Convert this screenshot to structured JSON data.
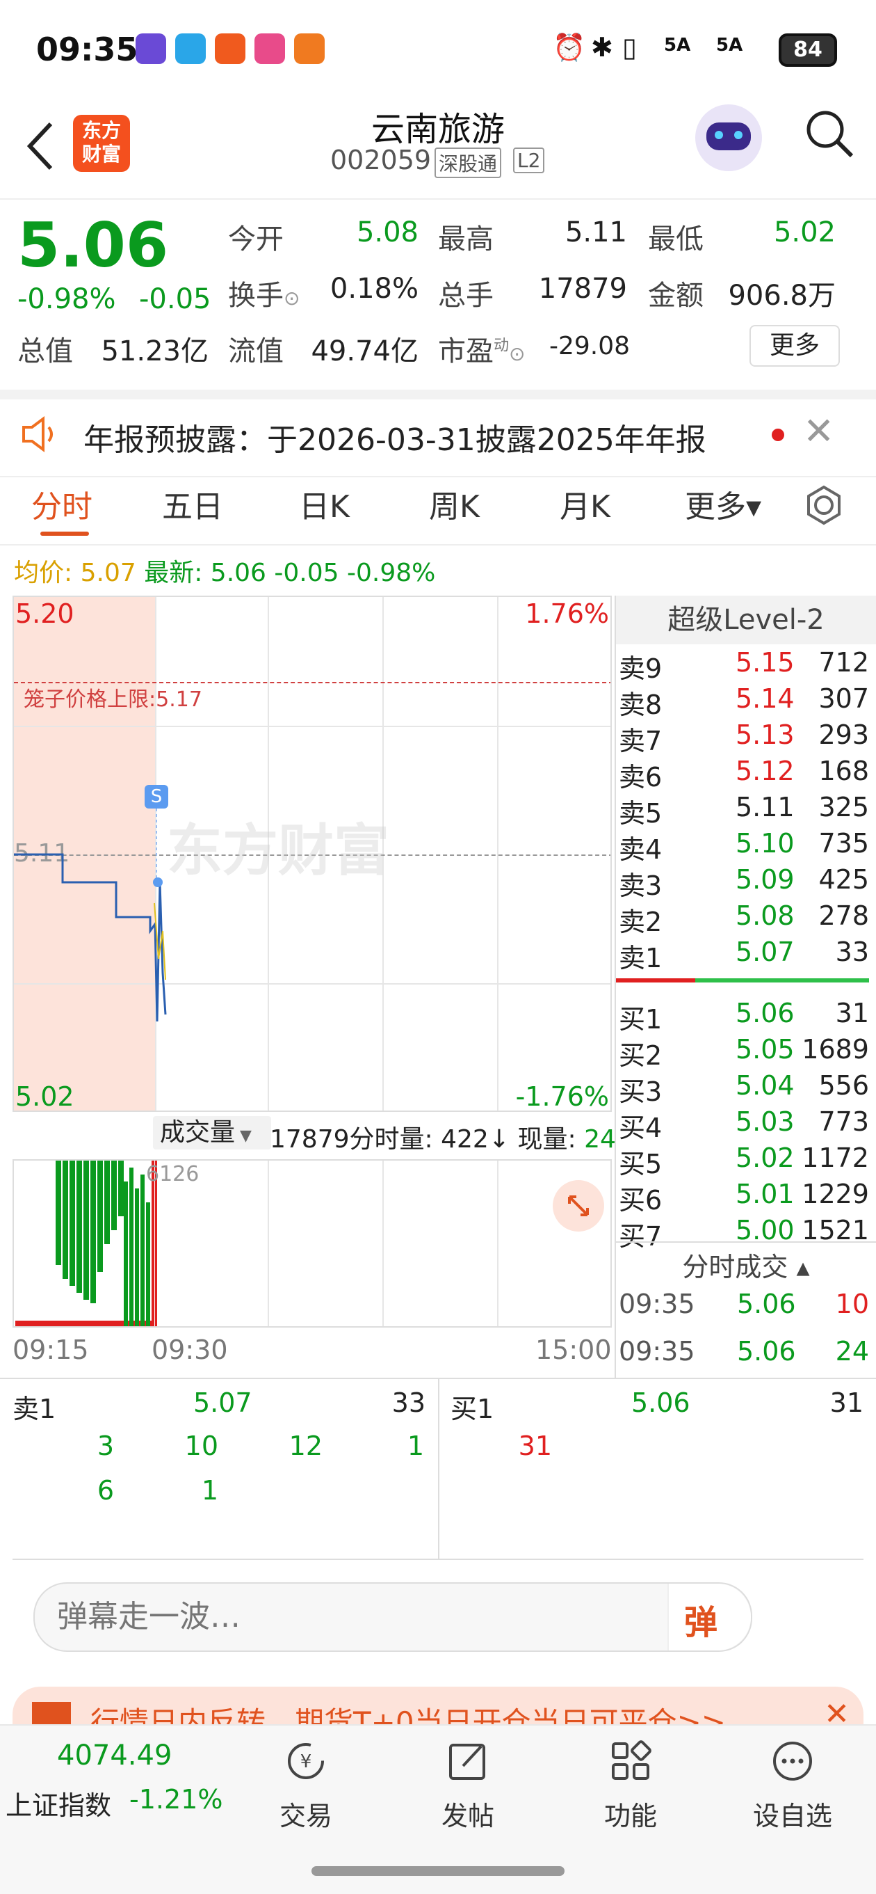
{
  "status_bar": {
    "time": "09:35",
    "battery": "84",
    "signal1": "5A",
    "signal2": "5A"
  },
  "header": {
    "logo_text_line1": "东方",
    "logo_text_line2": "财富",
    "stock_name": "云南旅游",
    "stock_code": "002059",
    "badge_market": "深股通",
    "badge_level": "L2"
  },
  "quote": {
    "price": "5.06",
    "change_pct": "-0.98%",
    "change": "-0.05",
    "open_label": "今开",
    "open": "5.08",
    "high_label": "最高",
    "high": "5.11",
    "low_label": "最低",
    "low": "5.02",
    "turnover_label": "换手",
    "turnover": "0.18%",
    "volume_label": "总手",
    "volume": "17879",
    "amount_label": "金额",
    "amount": "906.8万",
    "mktcap_label": "总值",
    "mktcap": "51.23亿",
    "float_label": "流值",
    "float": "49.74亿",
    "pe_label": "市盈",
    "pe_sup": "动",
    "pe": "-29.08",
    "more_label": "更多"
  },
  "notice": {
    "text": "年报预披露：于2026-03-31披露2025年年报"
  },
  "tabs": {
    "items": [
      "分时",
      "五日",
      "日K",
      "周K",
      "月K",
      "更多▾"
    ],
    "active": 0
  },
  "indicator": {
    "avg_label": "均价:",
    "avg": "5.07",
    "latest_label": "最新:",
    "latest": "5.06",
    "latest_change": "-0.05",
    "latest_pct": "-0.98%"
  },
  "chart": {
    "y_max": "5.20",
    "y_min": "5.02",
    "pct_max": "1.76%",
    "pct_min": "-1.76%",
    "prev_close": "5.11",
    "limit_label": "笼子价格上限:5.17",
    "watermark": "东方财富",
    "marker": "S",
    "x_start": "09:15",
    "x_mid": "09:30",
    "x_end": "15:00",
    "vol_label": "成交量",
    "vol_total": "17879",
    "vol_period_label": "分时量:",
    "vol_period": "422↓",
    "vol_now_label": "现量:",
    "vol_now": "24",
    "vol_max": "6126"
  },
  "orderbook": {
    "title": "超级Level-2",
    "asks": [
      {
        "label": "卖9",
        "price": "5.15",
        "qty": "712",
        "color": "#e02020"
      },
      {
        "label": "卖8",
        "price": "5.14",
        "qty": "307",
        "color": "#e02020"
      },
      {
        "label": "卖7",
        "price": "5.13",
        "qty": "293",
        "color": "#e02020"
      },
      {
        "label": "卖6",
        "price": "5.12",
        "qty": "168",
        "color": "#e02020"
      },
      {
        "label": "卖5",
        "price": "5.11",
        "qty": "325",
        "color": "#222222"
      },
      {
        "label": "卖4",
        "price": "5.10",
        "qty": "735",
        "color": "#0a9a1e"
      },
      {
        "label": "卖3",
        "price": "5.09",
        "qty": "425",
        "color": "#0a9a1e"
      },
      {
        "label": "卖2",
        "price": "5.08",
        "qty": "278",
        "color": "#0a9a1e"
      },
      {
        "label": "卖1",
        "price": "5.07",
        "qty": "33",
        "color": "#0a9a1e"
      }
    ],
    "bids": [
      {
        "label": "买1",
        "price": "5.06",
        "qty": "31",
        "color": "#0a9a1e"
      },
      {
        "label": "买2",
        "price": "5.05",
        "qty": "1689",
        "color": "#0a9a1e"
      },
      {
        "label": "买3",
        "price": "5.04",
        "qty": "556",
        "color": "#0a9a1e"
      },
      {
        "label": "买4",
        "price": "5.03",
        "qty": "773",
        "color": "#0a9a1e"
      },
      {
        "label": "买5",
        "price": "5.02",
        "qty": "1172",
        "color": "#0a9a1e"
      },
      {
        "label": "买6",
        "price": "5.01",
        "qty": "1229",
        "color": "#0a9a1e"
      },
      {
        "label": "买7",
        "price": "5.00",
        "qty": "1521",
        "color": "#0a9a1e"
      }
    ],
    "trades_title": "分时成交 ▴",
    "trades": [
      {
        "time": "09:35",
        "price": "5.06",
        "qty": "10"
      },
      {
        "time": "09:35",
        "price": "5.06",
        "qty": "24"
      }
    ]
  },
  "queue": {
    "sell_label": "卖1",
    "sell_price": "5.07",
    "sell_qty": "33",
    "buy_label": "买1",
    "buy_price": "5.06",
    "buy_qty": "31",
    "sell_orders_row1": [
      "3",
      "10",
      "12",
      "1"
    ],
    "sell_orders_row2": [
      "6",
      "1"
    ],
    "buy_orders_row1": [
      "31"
    ]
  },
  "danmu": {
    "placeholder": "弹幕走一波…",
    "button": "弹"
  },
  "banner": {
    "text": "行情日内反转，期货T+0当日开仓当日可平仓>>"
  },
  "bottom_nav": {
    "index_value": "4074.49",
    "index_name": "上证指数",
    "index_change": "-1.21%",
    "items": [
      "交易",
      "发帖",
      "功能",
      "设自选"
    ]
  }
}
